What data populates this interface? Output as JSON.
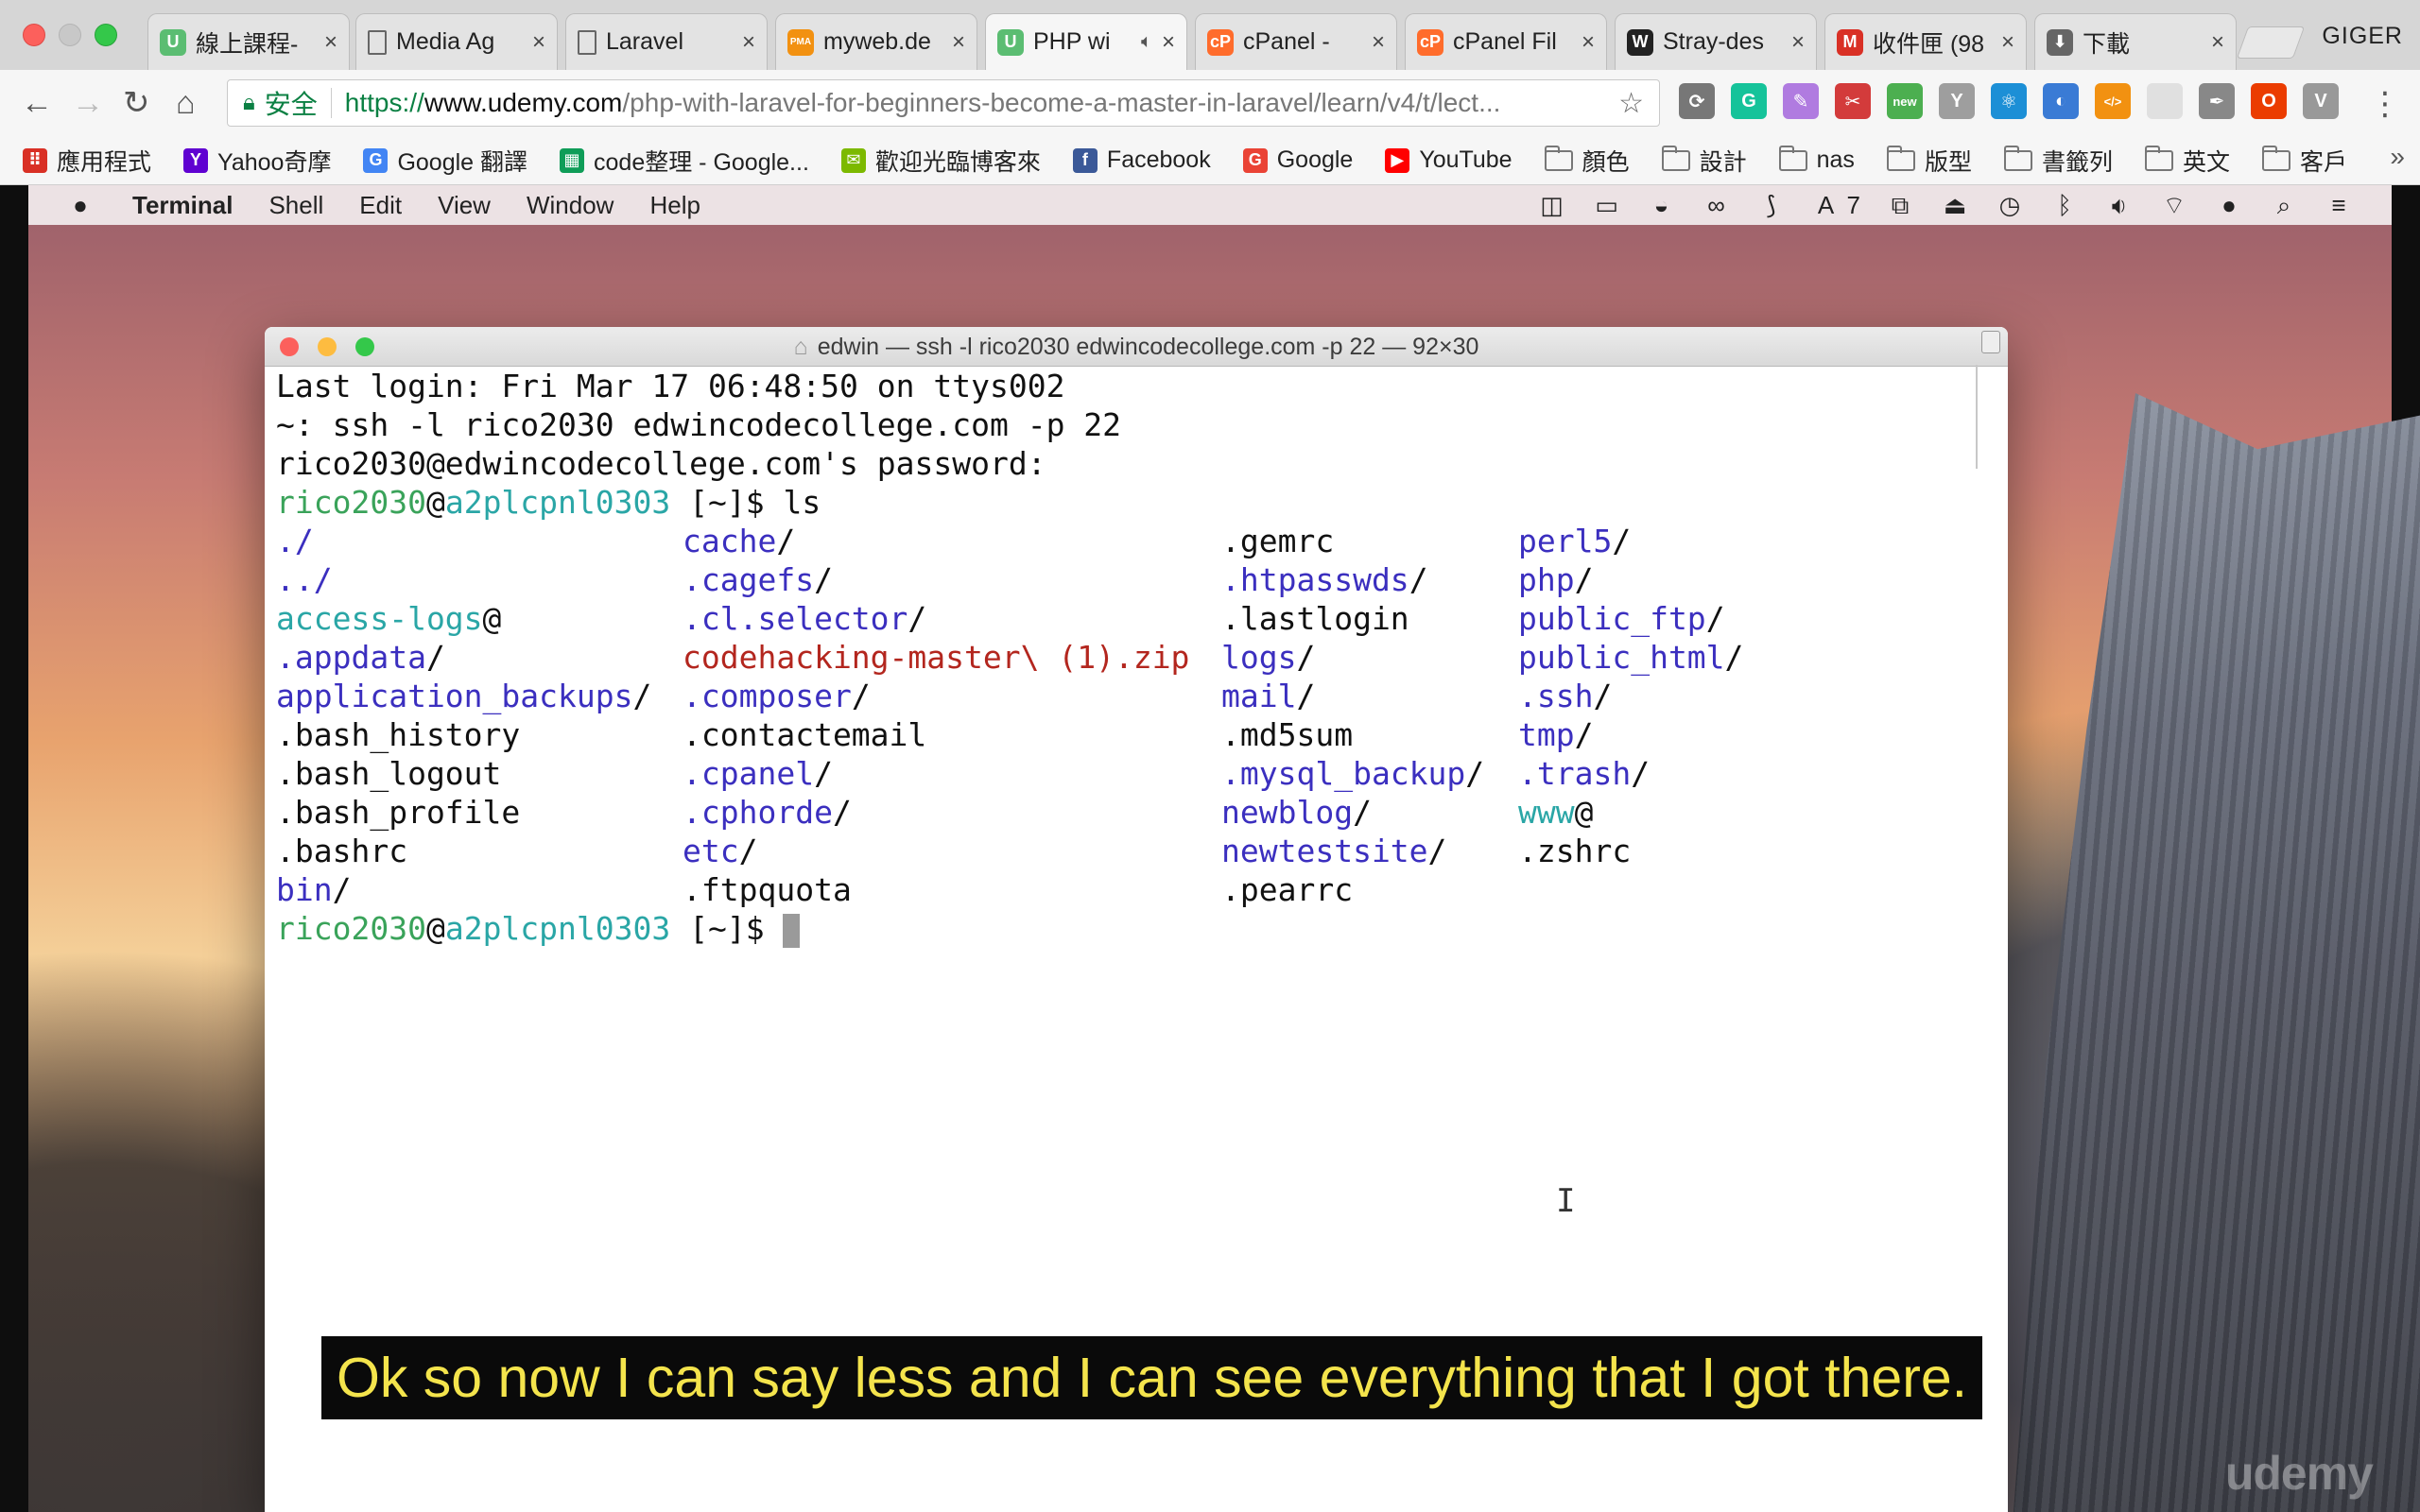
{
  "browser": {
    "tabs": [
      {
        "title": "線上課程- ",
        "favicon": "udemy-icon",
        "favicon_text": "U",
        "favicon_color": "#5bbd72",
        "active": false
      },
      {
        "title": "Media Ag",
        "favicon": "document-icon",
        "favicon_text": "",
        "favicon_color": "",
        "active": false
      },
      {
        "title": "Laravel",
        "favicon": "document-icon",
        "favicon_text": "",
        "favicon_color": "",
        "active": false
      },
      {
        "title": "myweb.de",
        "favicon": "phpmyadmin-icon",
        "favicon_text": "PMA",
        "favicon_color": "#f29111",
        "active": false
      },
      {
        "title": "PHP wi",
        "favicon": "udemy-icon",
        "favicon_text": "U",
        "favicon_color": "#5bbd72",
        "active": true
      },
      {
        "title": "cPanel - ",
        "favicon": "cpanel-icon",
        "favicon_text": "cP",
        "favicon_color": "#ff6c2c",
        "active": false
      },
      {
        "title": "cPanel Fil",
        "favicon": "cpanel-icon",
        "favicon_text": "cP",
        "favicon_color": "#ff6c2c",
        "active": false
      },
      {
        "title": "Stray-des",
        "favicon": "wordpress-icon",
        "favicon_text": "W",
        "favicon_color": "#222222",
        "active": false
      },
      {
        "title": "收件匣 (98",
        "favicon": "gmail-icon",
        "favicon_text": "M",
        "favicon_color": "#d93025",
        "active": false
      },
      {
        "title": "下載",
        "favicon": "download-icon",
        "favicon_text": "⬇",
        "favicon_color": "#666666",
        "active": false
      }
    ],
    "profile_name": "GIGER",
    "security_label": "安全",
    "url_scheme": "https://",
    "url_host": "www.udemy.com",
    "url_path": "/php-with-laravel-for-beginners-become-a-master-in-laravel/learn/v4/t/lect...",
    "bookmarks": [
      {
        "label": "應用程式",
        "icon": "apps-grid-icon",
        "icon_text": "⠿",
        "color": "#d93025"
      },
      {
        "label": "Yahoo奇摩",
        "icon": "yahoo-icon",
        "icon_text": "Y",
        "color": "#5f01d1"
      },
      {
        "label": "Google 翻譯",
        "icon": "google-translate-icon",
        "icon_text": "G",
        "color": "#4285f4"
      },
      {
        "label": "code整理 - Google...",
        "icon": "google-sheets-icon",
        "icon_text": "▦",
        "color": "#0f9d58"
      },
      {
        "label": "歡迎光臨博客來",
        "icon": "books-icon",
        "icon_text": "✉",
        "color": "#7cb900"
      },
      {
        "label": "Facebook",
        "icon": "facebook-icon",
        "icon_text": "f",
        "color": "#3b5998"
      },
      {
        "label": "Google",
        "icon": "google-icon",
        "icon_text": "G",
        "color": "#ea4335"
      },
      {
        "label": "YouTube",
        "icon": "youtube-icon",
        "icon_text": "▶",
        "color": "#ff0000"
      },
      {
        "label": "顏色",
        "icon": "folder-icon"
      },
      {
        "label": "設計",
        "icon": "folder-icon"
      },
      {
        "label": "nas",
        "icon": "folder-icon"
      },
      {
        "label": "版型",
        "icon": "folder-icon"
      },
      {
        "label": "書籤列",
        "icon": "folder-icon"
      },
      {
        "label": "英文",
        "icon": "folder-icon"
      },
      {
        "label": "客戶",
        "icon": "folder-icon"
      }
    ],
    "extensions": [
      {
        "name": "sync-icon",
        "text": "⟳",
        "color": "#777777"
      },
      {
        "name": "grammarly-icon",
        "text": "G",
        "color": "#15c39a"
      },
      {
        "name": "quill-icon",
        "text": "✎",
        "color": "#b07be0"
      },
      {
        "name": "scissors-icon",
        "text": "✂",
        "color": "#d33b3b"
      },
      {
        "name": "new-badge-icon",
        "text": "new",
        "color": "#4caf50"
      },
      {
        "name": "y-extension-icon",
        "text": "Y",
        "color": "#9e9e9e"
      },
      {
        "name": "react-icon",
        "text": "⚛",
        "color": "#1c8fd6"
      },
      {
        "name": "circle-extension-icon",
        "text": "◐",
        "color": "#3a7bd5"
      },
      {
        "name": "code-extension-icon",
        "text": "</>",
        "color": "#f29111"
      },
      {
        "name": "blank-extension-icon",
        "text": "",
        "color": "#e0e0e0"
      },
      {
        "name": "eyedropper-icon",
        "text": "✒",
        "color": "#888888"
      },
      {
        "name": "office-icon",
        "text": "O",
        "color": "#eb3c00"
      },
      {
        "name": "vue-icon",
        "text": "V",
        "color": "#999999"
      }
    ]
  },
  "mac": {
    "menus": [
      "Terminal",
      "Shell",
      "Edit",
      "View",
      "Window",
      "Help"
    ],
    "status_icons": [
      "camera-icon",
      "display-icon",
      "drive-icon",
      "creative-cloud-icon",
      "bracket-icon",
      "adobe-icon",
      "windows-icon",
      "airplay-icon",
      "time-machine-icon",
      "bluetooth-icon",
      "volume-icon",
      "wifi-icon",
      "user-icon",
      "spotlight-icon",
      "list-icon"
    ],
    "adobe_count": "7"
  },
  "terminal": {
    "title": "edwin — ssh -l rico2030 edwincodecollege.com -p 22 — 92×30",
    "last_login": "Last login: Fri Mar 17 06:48:50 on ttys002",
    "ssh_cmd": "~: ssh -l rico2030 edwincodecollege.com -p 22",
    "password_prompt": "rico2030@edwincodecollege.com's password:",
    "prompt_user": "rico2030",
    "prompt_at": "@",
    "prompt_host": "a2plcpnl0303",
    "prompt_dir": " [~]$ ",
    "command": "ls",
    "listing": [
      [
        {
          "n": "./",
          "t": "dir"
        },
        {
          "n": "cache",
          "s": "/",
          "t": "dir"
        },
        {
          "n": ".gemrc",
          "t": "norm"
        },
        {
          "n": "perl5",
          "s": "/",
          "t": "dir"
        }
      ],
      [
        {
          "n": "../",
          "t": "dir"
        },
        {
          "n": ".cagefs",
          "s": "/",
          "t": "dir"
        },
        {
          "n": ".htpasswds",
          "s": "/",
          "t": "dir"
        },
        {
          "n": "php",
          "s": "/",
          "t": "dir"
        }
      ],
      [
        {
          "n": "access-logs",
          "s": "@",
          "t": "link"
        },
        {
          "n": ".cl.selector",
          "s": "/",
          "t": "dir"
        },
        {
          "n": ".lastlogin",
          "t": "norm"
        },
        {
          "n": "public_ftp",
          "s": "/",
          "t": "dir"
        }
      ],
      [
        {
          "n": ".appdata",
          "s": "/",
          "t": "dir"
        },
        {
          "n": "codehacking-master\\ (1).zip",
          "t": "arc"
        },
        {
          "n": "logs",
          "s": "/",
          "t": "dir"
        },
        {
          "n": "public_html",
          "s": "/",
          "t": "dir"
        }
      ],
      [
        {
          "n": "application_backups",
          "s": "/",
          "t": "dir"
        },
        {
          "n": ".composer",
          "s": "/",
          "t": "dir"
        },
        {
          "n": "mail",
          "s": "/",
          "t": "dir"
        },
        {
          "n": ".ssh",
          "s": "/",
          "t": "dir"
        }
      ],
      [
        {
          "n": ".bash_history",
          "t": "norm"
        },
        {
          "n": ".contactemail",
          "t": "norm"
        },
        {
          "n": ".md5sum",
          "t": "norm"
        },
        {
          "n": "tmp",
          "s": "/",
          "t": "dir"
        }
      ],
      [
        {
          "n": ".bash_logout",
          "t": "norm"
        },
        {
          "n": ".cpanel",
          "s": "/",
          "t": "dir"
        },
        {
          "n": ".mysql_backup",
          "s": "/",
          "t": "dir"
        },
        {
          "n": ".trash",
          "s": "/",
          "t": "dir"
        }
      ],
      [
        {
          "n": ".bash_profile",
          "t": "norm"
        },
        {
          "n": ".cphorde",
          "s": "/",
          "t": "dir"
        },
        {
          "n": "newblog",
          "s": "/",
          "t": "dir"
        },
        {
          "n": "www",
          "s": "@",
          "t": "link"
        }
      ],
      [
        {
          "n": ".bashrc",
          "t": "norm"
        },
        {
          "n": "etc",
          "s": "/",
          "t": "dir"
        },
        {
          "n": "newtestsite",
          "s": "/",
          "t": "dir"
        },
        {
          "n": ".zshrc",
          "t": "norm"
        }
      ],
      [
        {
          "n": "bin",
          "s": "/",
          "t": "dir"
        },
        {
          "n": ".ftpquota",
          "t": "norm"
        },
        {
          "n": ".pearrc",
          "t": "norm"
        },
        null
      ]
    ]
  },
  "subtitle": "Ok so now I can say less and I can see everything that I got there.",
  "watermark": "udemy"
}
